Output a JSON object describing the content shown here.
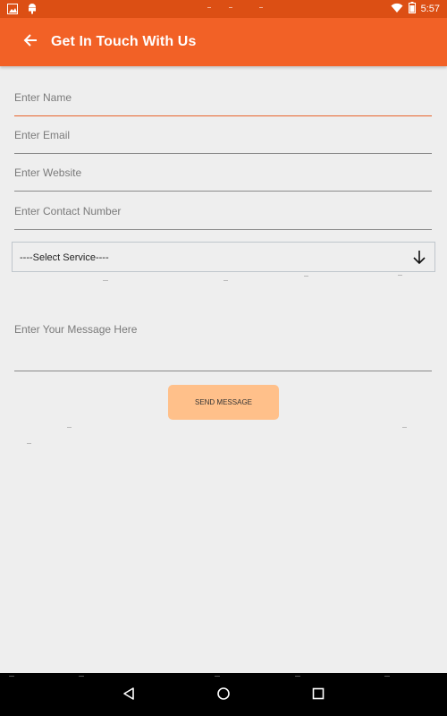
{
  "status_bar": {
    "time": "5:57",
    "left_icons": [
      "image-icon",
      "android-icon"
    ],
    "right_icons": [
      "wifi-icon",
      "battery-icon"
    ]
  },
  "app_bar": {
    "title": "Get In Touch With Us",
    "back_icon": "arrow-left-icon",
    "color": "#f26126"
  },
  "form": {
    "name_placeholder": "Enter Name",
    "email_placeholder": "Enter Email",
    "website_placeholder": "Enter Website",
    "contact_placeholder": "Enter Contact Number",
    "service_select": {
      "selected": "----Select Service----",
      "icon": "arrow-down-icon"
    },
    "message_placeholder": "Enter Your Message Here",
    "submit_label": "SEND MESSAGE",
    "submit_color": "#ffc08a",
    "active_underline_color": "#e8642c"
  },
  "nav_bar": {
    "buttons": [
      "back-triangle-icon",
      "home-circle-icon",
      "recents-square-icon"
    ]
  }
}
